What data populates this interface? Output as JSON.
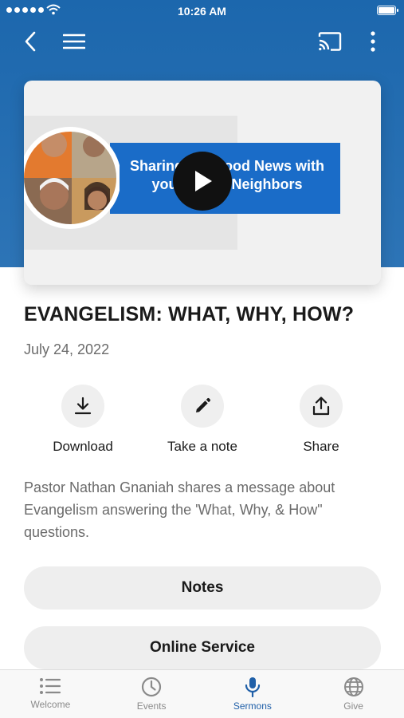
{
  "status_bar": {
    "time": "10:26 AM",
    "battery_level": 1.0
  },
  "header": {
    "back_icon": "chevron-left-icon",
    "menu_icon": "hamburger-icon",
    "cast_icon": "cast-icon",
    "more_icon": "more-vertical-icon"
  },
  "video": {
    "banner_text": "Sharing the Good News with your Hindu Neighbors",
    "play_icon": "play-icon"
  },
  "sermon": {
    "title": "EVANGELISM: WHAT, WHY, HOW?",
    "date": "July 24, 2022",
    "description": "Pastor Nathan Gnaniah shares a message about Evangelism answering the 'What, Why, & How\" questions."
  },
  "actions": [
    {
      "label": "Download",
      "icon": "download-icon"
    },
    {
      "label": "Take a note",
      "icon": "pencil-icon"
    },
    {
      "label": "Share",
      "icon": "share-icon"
    }
  ],
  "buttons": {
    "notes": "Notes",
    "online_service": "Online Service"
  },
  "tabs": [
    {
      "label": "Welcome",
      "icon": "list-icon",
      "active": false
    },
    {
      "label": "Events",
      "icon": "clock-icon",
      "active": false
    },
    {
      "label": "Sermons",
      "icon": "microphone-icon",
      "active": true
    },
    {
      "label": "Give",
      "icon": "globe-icon",
      "active": false
    }
  ],
  "colors": {
    "header_blue": "#1c67ad",
    "active_tab": "#1f5fa8",
    "banner_blue": "#1a6cc8"
  }
}
